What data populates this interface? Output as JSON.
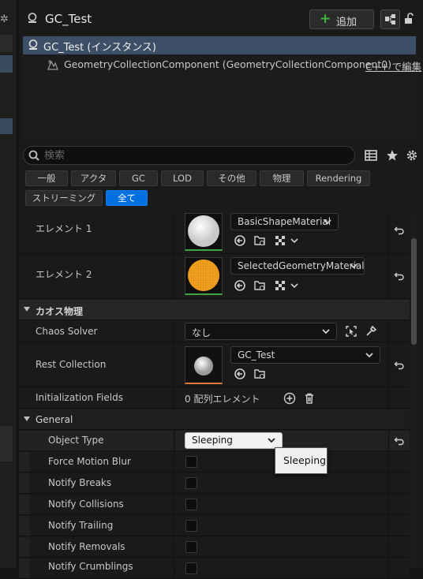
{
  "window": {
    "title": "GC_Test"
  },
  "toolbar": {
    "add_label": "追加",
    "add_icon": "plus-icon",
    "blueprint_icon": "blueprint-icon",
    "lock_icon": "lock-icon"
  },
  "tree": {
    "root": "GC_Test (インスタンス)",
    "child": "GeometryCollectionComponent (GeometryCollectionComponent0)",
    "child_link": "C++ で編集"
  },
  "search": {
    "placeholder": "検索"
  },
  "filters": [
    {
      "label": "一般",
      "active": false
    },
    {
      "label": "アクタ",
      "active": false
    },
    {
      "label": "GC",
      "active": false
    },
    {
      "label": "LOD",
      "active": false
    },
    {
      "label": "その他",
      "active": false
    },
    {
      "label": "物理",
      "active": false
    },
    {
      "label": "Rendering",
      "active": false
    },
    {
      "label": "ストリーミング",
      "active": false
    },
    {
      "label": "全て",
      "active": true
    }
  ],
  "materials": [
    {
      "label": "エレメント 1",
      "material": "BasicShapeMaterial",
      "swatch_color": "#f2f2f2"
    },
    {
      "label": "エレメント 2",
      "material": "SelectedGeometryMaterial",
      "swatch_color": "#f0a020"
    }
  ],
  "chaos": {
    "title": "カオス物理",
    "solver_label": "Chaos Solver",
    "solver_value": "なし",
    "rest_label": "Rest Collection",
    "rest_value": "GC_Test",
    "init_label": "Initialization Fields",
    "init_value": "0 配列エレメント"
  },
  "general": {
    "title": "General",
    "object_type_label": "Object Type",
    "object_type_value": "Sleeping",
    "flags": [
      {
        "label": "Force Motion Blur",
        "checked": false
      },
      {
        "label": "Notify Breaks",
        "checked": false
      },
      {
        "label": "Notify Collisions",
        "checked": false
      },
      {
        "label": "Notify Trailing",
        "checked": false
      },
      {
        "label": "Notify Removals",
        "checked": false
      },
      {
        "label": "Notify Crumblings",
        "checked": false
      }
    ]
  },
  "tooltip": {
    "text": "Sleeping"
  },
  "colors": {
    "accent": "#0070e0",
    "selection": "#3d4f66",
    "add_plus": "#3fba3f"
  }
}
